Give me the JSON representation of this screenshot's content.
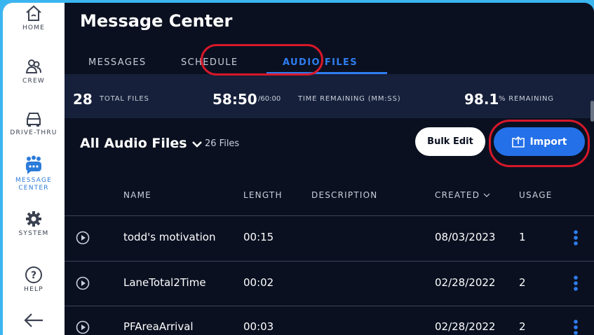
{
  "sidebar": {
    "items": [
      {
        "label": "HOME",
        "icon": "home-icon"
      },
      {
        "label": "CREW",
        "icon": "crew-icon"
      },
      {
        "label": "DRIVE-THRU",
        "icon": "car-icon"
      },
      {
        "label": "MESSAGE",
        "label2": "CENTER",
        "icon": "message-center-icon",
        "active": true
      },
      {
        "label": "SYSTEM",
        "icon": "gear-icon"
      },
      {
        "label": "HELP",
        "icon": "help-icon"
      }
    ],
    "back_icon": "back-arrow-icon"
  },
  "header": {
    "title": "Message Center"
  },
  "tabs": [
    {
      "label": "MESSAGES"
    },
    {
      "label": "SCHEDULE"
    },
    {
      "label": "AUDIO FILES",
      "active": true
    }
  ],
  "stats": {
    "total_files_value": "28",
    "total_files_label": "TOTAL FILES",
    "time_value": "58:50",
    "time_max": "/60:00",
    "time_label": "TIME REMAINING (MM:SS)",
    "percent_value": "98.1",
    "percent_label": "% REMAINING"
  },
  "filter": {
    "title": "All Audio Files",
    "count": "26 Files",
    "bulk_edit_label": "Bulk Edit",
    "import_label": "Import"
  },
  "table": {
    "headers": {
      "name": "NAME",
      "length": "LENGTH",
      "description": "DESCRIPTION",
      "created": "CREATED",
      "usage": "USAGE"
    },
    "rows": [
      {
        "name": "todd's motivation",
        "length": "00:15",
        "description": "",
        "created": "08/03/2023",
        "usage": "1"
      },
      {
        "name": "LaneTotal2Time",
        "length": "00:02",
        "description": "",
        "created": "02/28/2022",
        "usage": "2"
      },
      {
        "name": "PFAreaArrival",
        "length": "00:03",
        "description": "",
        "created": "02/28/2022",
        "usage": "2"
      }
    ]
  },
  "colors": {
    "accent": "#2f7df0",
    "highlight": "#d8182a",
    "background": "#0a1020",
    "frame": "#3bb5f0"
  }
}
